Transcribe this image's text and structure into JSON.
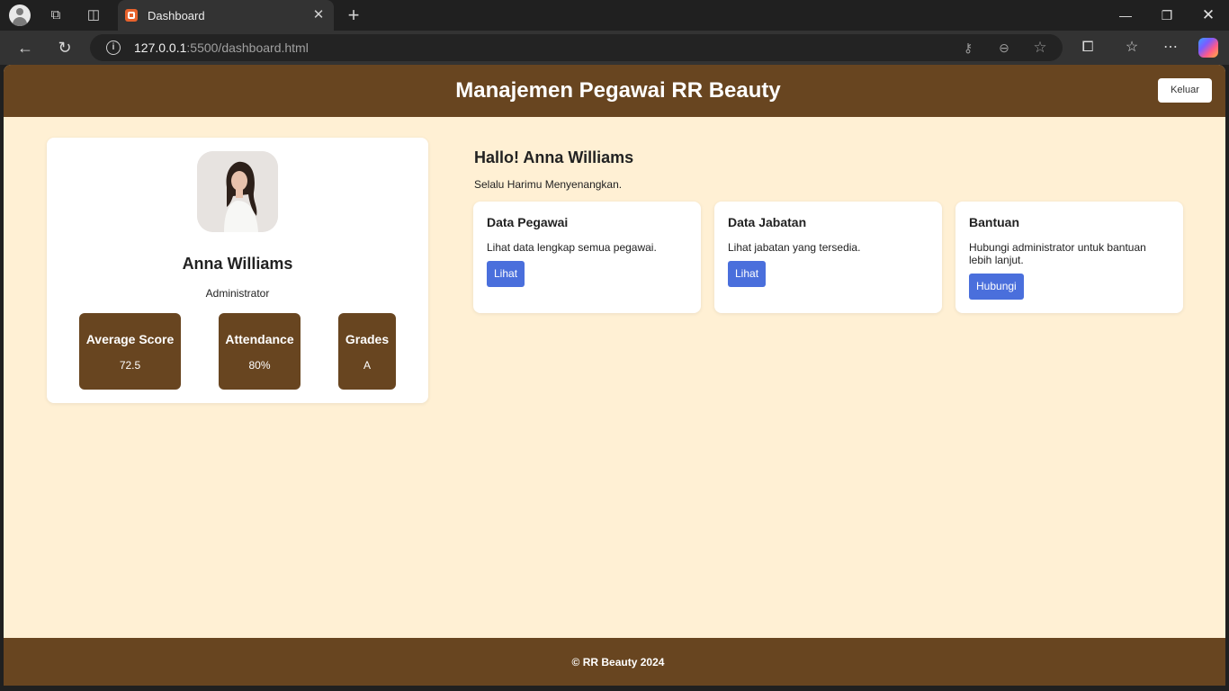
{
  "browser": {
    "tab_title": "Dashboard",
    "url_host": "127.0.0.1",
    "url_rest": ":5500/dashboard.html"
  },
  "header": {
    "title": "Manajemen Pegawai RR Beauty",
    "logout_label": "Keluar"
  },
  "profile": {
    "name": "Anna Williams",
    "role": "Administrator",
    "stats": [
      {
        "label": "Average Score",
        "value": "72.5"
      },
      {
        "label": "Attendance",
        "value": "80%"
      },
      {
        "label": "Grades",
        "value": "A"
      }
    ]
  },
  "main": {
    "greeting": "Hallo! Anna Williams",
    "subtitle": "Selalu Harimu Menyenangkan.",
    "cards": [
      {
        "title": "Data Pegawai",
        "description": "Lihat data lengkap semua pegawai.",
        "button": "Lihat"
      },
      {
        "title": "Data Jabatan",
        "description": "Lihat jabatan yang tersedia.",
        "button": "Lihat"
      },
      {
        "title": "Bantuan",
        "description": "Hubungi administrator untuk bantuan lebih lanjut.",
        "button": "Hubungi"
      }
    ]
  },
  "footer": {
    "copyright": "© RR Beauty 2024"
  },
  "colors": {
    "brand_brown": "#684520",
    "page_background": "#fff0d4",
    "button_blue": "#4a6fdc"
  }
}
